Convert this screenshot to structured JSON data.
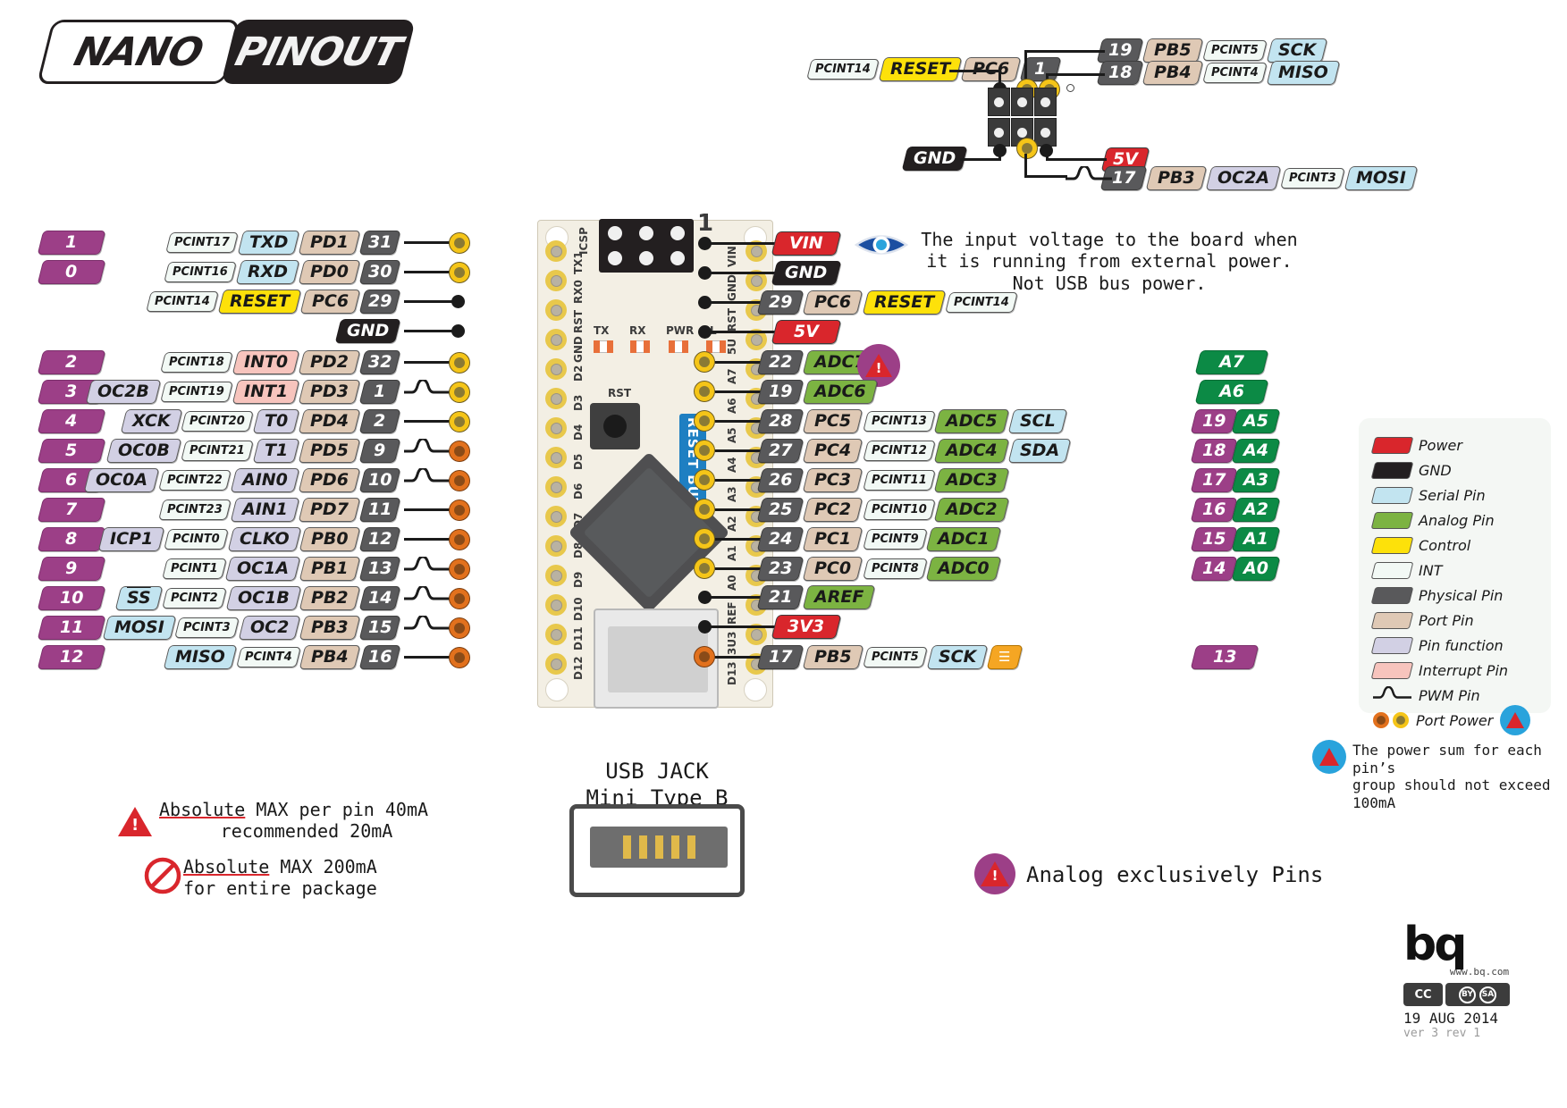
{
  "title": {
    "part1": "NANO",
    "part2": "PINOUT"
  },
  "board": {
    "icsp_label": "ICSP",
    "icsp_pin1": "1",
    "reset_button_label": "RESET BUTTON",
    "silk_left": [
      "TX1",
      "RX0",
      "RST",
      "GND",
      "D2",
      "D3",
      "D4",
      "D5",
      "D6",
      "D7",
      "D8",
      "D9",
      "D10",
      "D11",
      "D12",
      "D13"
    ],
    "silk_right": [
      "VIN",
      "GND",
      "RST",
      "5U",
      "A7",
      "A6",
      "A5",
      "A4",
      "A3",
      "A2",
      "A1",
      "A0",
      "REF",
      "3U3",
      "D13"
    ],
    "silk_marks": [
      "TX",
      "RX",
      "PWR",
      "L"
    ],
    "rst_label": "RST"
  },
  "usb_jack": {
    "line1": "USB JACK",
    "line2": "Mini Type B"
  },
  "icsp_top": {
    "reset_row": {
      "int": "PCINT14",
      "ctrl": "RESET",
      "port": "PC6",
      "phys": "1"
    },
    "pb5_row": {
      "phys": "19",
      "port": "PB5",
      "int": "PCINT5",
      "serial": "SCK"
    },
    "pb4_row": {
      "phys": "18",
      "port": "PB4",
      "int": "PCINT4",
      "serial": "MISO"
    },
    "gnd": "GND",
    "v5": "5V",
    "pb3_row": {
      "phys": "17",
      "port": "PB3",
      "func": "OC2A",
      "int": "PCINT3",
      "serial": "MOSI"
    }
  },
  "left_rows": [
    {
      "digital": "1",
      "tags": [
        {
          "t": "int",
          "v": "PCINT17"
        },
        {
          "t": "serial",
          "v": "TXD"
        },
        {
          "t": "port",
          "v": "PD1"
        },
        {
          "t": "phys",
          "v": "31"
        }
      ],
      "dot": "yellow",
      "pwm": false
    },
    {
      "digital": "0",
      "tags": [
        {
          "t": "int",
          "v": "PCINT16"
        },
        {
          "t": "serial",
          "v": "RXD"
        },
        {
          "t": "port",
          "v": "PD0"
        },
        {
          "t": "phys",
          "v": "30"
        }
      ],
      "dot": "yellow",
      "pwm": false
    },
    {
      "digital": "",
      "tags": [
        {
          "t": "int",
          "v": "PCINT14"
        },
        {
          "t": "control",
          "v": "RESET"
        },
        {
          "t": "port",
          "v": "PC6"
        },
        {
          "t": "phys",
          "v": "29"
        }
      ],
      "dot": "black",
      "pwm": false
    },
    {
      "digital": "",
      "tags": [
        {
          "t": "gnd",
          "v": "GND"
        }
      ],
      "dot": "black",
      "pwm": false
    },
    {
      "digital": "2",
      "tags": [
        {
          "t": "int",
          "v": "PCINT18"
        },
        {
          "t": "intr",
          "v": "INT0"
        },
        {
          "t": "port",
          "v": "PD2"
        },
        {
          "t": "phys",
          "v": "32"
        }
      ],
      "dot": "yellow",
      "pwm": false
    },
    {
      "digital": "3",
      "tags": [
        {
          "t": "func",
          "v": "OC2B"
        },
        {
          "t": "int",
          "v": "PCINT19"
        },
        {
          "t": "intr",
          "v": "INT1"
        },
        {
          "t": "port",
          "v": "PD3"
        },
        {
          "t": "phys",
          "v": "1"
        }
      ],
      "dot": "yellow",
      "pwm": true
    },
    {
      "digital": "4",
      "tags": [
        {
          "t": "func",
          "v": "XCK"
        },
        {
          "t": "int",
          "v": "PCINT20"
        },
        {
          "t": "func",
          "v": "T0"
        },
        {
          "t": "port",
          "v": "PD4"
        },
        {
          "t": "phys",
          "v": "2"
        }
      ],
      "dot": "yellow",
      "pwm": false
    },
    {
      "digital": "5",
      "tags": [
        {
          "t": "func",
          "v": "OC0B"
        },
        {
          "t": "int",
          "v": "PCINT21"
        },
        {
          "t": "func",
          "v": "T1"
        },
        {
          "t": "port",
          "v": "PD5"
        },
        {
          "t": "phys",
          "v": "9"
        }
      ],
      "dot": "orange",
      "pwm": true
    },
    {
      "digital": "6",
      "tags": [
        {
          "t": "func",
          "v": "OC0A"
        },
        {
          "t": "int",
          "v": "PCINT22"
        },
        {
          "t": "func",
          "v": "AIN0"
        },
        {
          "t": "port",
          "v": "PD6"
        },
        {
          "t": "phys",
          "v": "10"
        }
      ],
      "dot": "orange",
      "pwm": true
    },
    {
      "digital": "7",
      "tags": [
        {
          "t": "int",
          "v": "PCINT23"
        },
        {
          "t": "func",
          "v": "AIN1"
        },
        {
          "t": "port",
          "v": "PD7"
        },
        {
          "t": "phys",
          "v": "11"
        }
      ],
      "dot": "orange",
      "pwm": false
    },
    {
      "digital": "8",
      "tags": [
        {
          "t": "func",
          "v": "ICP1"
        },
        {
          "t": "int",
          "v": "PCINT0"
        },
        {
          "t": "func",
          "v": "CLKO"
        },
        {
          "t": "port",
          "v": "PB0"
        },
        {
          "t": "phys",
          "v": "12"
        }
      ],
      "dot": "orange",
      "pwm": false
    },
    {
      "digital": "9",
      "tags": [
        {
          "t": "int",
          "v": "PCINT1"
        },
        {
          "t": "func",
          "v": "OC1A"
        },
        {
          "t": "port",
          "v": "PB1"
        },
        {
          "t": "phys",
          "v": "13"
        }
      ],
      "dot": "orange",
      "pwm": true
    },
    {
      "digital": "10",
      "tags": [
        {
          "t": "serial",
          "v": "SS"
        },
        {
          "t": "int",
          "v": "PCINT2"
        },
        {
          "t": "func",
          "v": "OC1B"
        },
        {
          "t": "port",
          "v": "PB2"
        },
        {
          "t": "phys",
          "v": "14"
        }
      ],
      "dot": "orange",
      "pwm": true
    },
    {
      "digital": "11",
      "tags": [
        {
          "t": "serial",
          "v": "MOSI"
        },
        {
          "t": "int",
          "v": "PCINT3"
        },
        {
          "t": "func",
          "v": "OC2"
        },
        {
          "t": "port",
          "v": "PB3"
        },
        {
          "t": "phys",
          "v": "15"
        }
      ],
      "dot": "orange",
      "pwm": true
    },
    {
      "digital": "12",
      "tags": [
        {
          "t": "serial",
          "v": "MISO"
        },
        {
          "t": "int",
          "v": "PCINT4"
        },
        {
          "t": "port",
          "v": "PB4"
        },
        {
          "t": "phys",
          "v": "16"
        }
      ],
      "dot": "orange",
      "pwm": false
    }
  ],
  "right_rows": [
    {
      "tags": [
        {
          "t": "power",
          "v": "VIN"
        }
      ],
      "dot": "black",
      "analog": ""
    },
    {
      "tags": [
        {
          "t": "gnd",
          "v": "GND"
        }
      ],
      "dot": "black",
      "analog": ""
    },
    {
      "tags": [
        {
          "t": "phys",
          "v": "29"
        },
        {
          "t": "port",
          "v": "PC6"
        },
        {
          "t": "control",
          "v": "RESET"
        },
        {
          "t": "int",
          "v": "PCINT14"
        }
      ],
      "dot": "black",
      "analog": ""
    },
    {
      "tags": [
        {
          "t": "power",
          "v": "5V"
        }
      ],
      "dot": "black",
      "analog": ""
    },
    {
      "tags": [
        {
          "t": "phys",
          "v": "22"
        },
        {
          "t": "analog",
          "v": "ADC7"
        }
      ],
      "dot": "yellow",
      "analog": "A7",
      "analog_digital": ""
    },
    {
      "tags": [
        {
          "t": "phys",
          "v": "19"
        },
        {
          "t": "analog",
          "v": "ADC6"
        }
      ],
      "dot": "yellow",
      "analog": "A6",
      "analog_digital": ""
    },
    {
      "tags": [
        {
          "t": "phys",
          "v": "28"
        },
        {
          "t": "port",
          "v": "PC5"
        },
        {
          "t": "int",
          "v": "PCINT13"
        },
        {
          "t": "analog",
          "v": "ADC5"
        },
        {
          "t": "serial",
          "v": "SCL"
        }
      ],
      "dot": "yellow",
      "analog": "A5",
      "analog_digital": "19"
    },
    {
      "tags": [
        {
          "t": "phys",
          "v": "27"
        },
        {
          "t": "port",
          "v": "PC4"
        },
        {
          "t": "int",
          "v": "PCINT12"
        },
        {
          "t": "analog",
          "v": "ADC4"
        },
        {
          "t": "serial",
          "v": "SDA"
        }
      ],
      "dot": "yellow",
      "analog": "A4",
      "analog_digital": "18"
    },
    {
      "tags": [
        {
          "t": "phys",
          "v": "26"
        },
        {
          "t": "port",
          "v": "PC3"
        },
        {
          "t": "int",
          "v": "PCINT11"
        },
        {
          "t": "analog",
          "v": "ADC3"
        }
      ],
      "dot": "yellow",
      "analog": "A3",
      "analog_digital": "17"
    },
    {
      "tags": [
        {
          "t": "phys",
          "v": "25"
        },
        {
          "t": "port",
          "v": "PC2"
        },
        {
          "t": "int",
          "v": "PCINT10"
        },
        {
          "t": "analog",
          "v": "ADC2"
        }
      ],
      "dot": "yellow",
      "analog": "A2",
      "analog_digital": "16"
    },
    {
      "tags": [
        {
          "t": "phys",
          "v": "24"
        },
        {
          "t": "port",
          "v": "PC1"
        },
        {
          "t": "int",
          "v": "PCINT9"
        },
        {
          "t": "analog",
          "v": "ADC1"
        }
      ],
      "dot": "yellow",
      "analog": "A1",
      "analog_digital": "15"
    },
    {
      "tags": [
        {
          "t": "phys",
          "v": "23"
        },
        {
          "t": "port",
          "v": "PC0"
        },
        {
          "t": "int",
          "v": "PCINT8"
        },
        {
          "t": "analog",
          "v": "ADC0"
        }
      ],
      "dot": "yellow",
      "analog": "A0",
      "analog_digital": "14"
    },
    {
      "tags": [
        {
          "t": "phys",
          "v": "21"
        },
        {
          "t": "analog",
          "v": "AREF"
        }
      ],
      "dot": "black",
      "analog": ""
    },
    {
      "tags": [
        {
          "t": "power",
          "v": "3V3"
        }
      ],
      "dot": "black",
      "analog": ""
    },
    {
      "tags": [
        {
          "t": "phys",
          "v": "17"
        },
        {
          "t": "port",
          "v": "PB5"
        },
        {
          "t": "int",
          "v": "PCINT5"
        },
        {
          "t": "serial",
          "v": "SCK"
        }
      ],
      "dot": "orange",
      "analog": "",
      "analog_digital": "13",
      "led": true
    }
  ],
  "vin_note": "The input voltage to the board when\nit is running from external power.\nNot USB bus power.",
  "legend": {
    "items": [
      {
        "color": "#d9262c",
        "label": "Power",
        "key": "power"
      },
      {
        "color": "#231f20",
        "label": "GND",
        "key": "gnd"
      },
      {
        "color": "#c2e4f0",
        "label": "Serial Pin",
        "key": "serial"
      },
      {
        "color": "#7cb342",
        "label": "Analog Pin",
        "key": "analog"
      },
      {
        "color": "#fde10a",
        "label": "Control",
        "key": "control"
      },
      {
        "color": "#f2f9f5",
        "label": "INT",
        "key": "int"
      },
      {
        "color": "#59595b",
        "label": "Physical Pin",
        "key": "phys"
      },
      {
        "color": "#dfc9b5",
        "label": "Port Pin",
        "key": "port"
      },
      {
        "color": "#d2d0e4",
        "label": "Pin function",
        "key": "func"
      },
      {
        "color": "#f7c4bd",
        "label": "Interrupt Pin",
        "key": "intr"
      }
    ],
    "pwm_label": "PWM Pin",
    "port_power_label": "Port Power"
  },
  "notes": {
    "power_sum": "The power sum for each pin's\ngroup should not exceed 100mA",
    "max_per_pin_line1_a": "Absolute",
    "max_per_pin_line1_b": " MAX per pin 40mA",
    "max_per_pin_line2": "recommended 20mA",
    "max_package_line1_a": "Absolute",
    "max_package_line1_b": " MAX 200mA",
    "max_package_line2": "for entire package",
    "analog_exclusive": "Analog exclusively Pins"
  },
  "footer": {
    "brand": "bq",
    "url": "www.bq.com",
    "cc": "CC",
    "cc_by": "BY",
    "cc_sa": "SA",
    "date": "19 AUG 2014",
    "version": "ver 3 rev 1"
  }
}
